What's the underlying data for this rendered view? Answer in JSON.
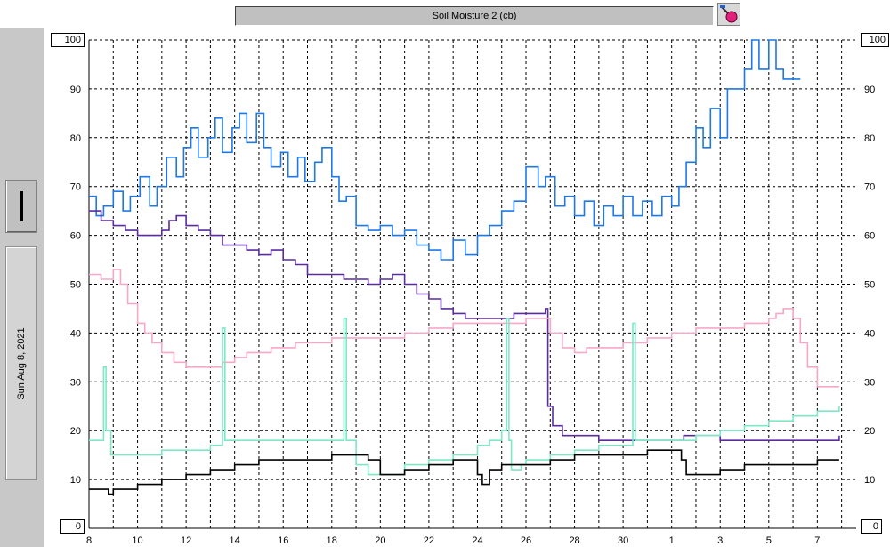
{
  "window": {
    "title": "Soil Moisture 2 (cb)"
  },
  "sidebar": {
    "date_label": "Sun Aug 8, 2021"
  },
  "axis_boxes": {
    "y_top": "100",
    "y_bottom": "0"
  },
  "colors": {
    "background": "#ffffff",
    "grid": "#000000",
    "series": [
      "#1e78e6",
      "#5a2ca0",
      "#f5a8c8",
      "#7ee8c4",
      "#000000"
    ]
  },
  "icons": {
    "title_icon": "paint-brush-icon",
    "sidebar_button": "vertical-bar-icon"
  },
  "chart_data": {
    "type": "line",
    "title": "Soil Moisture 2 (cb)",
    "xlabel": "",
    "ylabel": "",
    "ylim": [
      0,
      100
    ],
    "xlim": [
      8,
      39.6
    ],
    "x_ticks": [
      8,
      9,
      10,
      11,
      12,
      13,
      14,
      15,
      16,
      17,
      18,
      19,
      20,
      21,
      22,
      23,
      24,
      25,
      26,
      27,
      28,
      29,
      30,
      31,
      32,
      33,
      34,
      35,
      36,
      37,
      38,
      39
    ],
    "x_tick_labels": [
      "8",
      "",
      "10",
      "",
      "12",
      "",
      "14",
      "",
      "16",
      "",
      "18",
      "",
      "20",
      "",
      "22",
      "",
      "24",
      "",
      "26",
      "",
      "28",
      "",
      "30",
      "",
      "1",
      "",
      "3",
      "",
      "5",
      "",
      "7",
      ""
    ],
    "y_ticks": [
      10,
      20,
      30,
      40,
      50,
      60,
      70,
      80,
      90,
      100
    ],
    "y_tick_labels": [
      "10",
      "20",
      "30",
      "40",
      "50",
      "60",
      "70",
      "80",
      "90",
      "100"
    ],
    "grid": true,
    "legend": "none",
    "series": [
      {
        "color": "#1e78e6",
        "x": [
          8,
          8.3,
          8.6,
          9,
          9.4,
          9.7,
          10.1,
          10.5,
          10.8,
          11.2,
          11.6,
          11.9,
          12.2,
          12.5,
          12.9,
          13.2,
          13.5,
          13.9,
          14.2,
          14.5,
          14.9,
          15.2,
          15.5,
          15.9,
          16.2,
          16.6,
          16.9,
          17.3,
          17.6,
          18,
          18.3,
          18.6,
          19,
          19.5,
          20,
          20.5,
          21,
          21.5,
          22,
          22.5,
          23,
          23.5,
          24,
          24.5,
          25,
          25.5,
          26,
          26.5,
          26.8,
          27.2,
          27.6,
          28,
          28.4,
          28.8,
          29.2,
          29.6,
          30,
          30.4,
          30.8,
          31.2,
          31.6,
          32,
          32.3,
          32.6,
          33,
          33.3,
          33.6,
          34,
          34.3,
          34.6,
          35,
          35.3,
          35.6,
          36,
          36.3,
          36.6,
          37,
          37.3
        ],
        "values": [
          68,
          64,
          66,
          69,
          65,
          68,
          72,
          66,
          70,
          76,
          72,
          78,
          82,
          76,
          80,
          84,
          77,
          82,
          85,
          79,
          85,
          78,
          74,
          77,
          72,
          76,
          71,
          75,
          78,
          72,
          67,
          68,
          62,
          61,
          62,
          60,
          61,
          58,
          57,
          55,
          59,
          56,
          60,
          62,
          65,
          67,
          74,
          70,
          72,
          66,
          68,
          64,
          67,
          62,
          66,
          64,
          68,
          64,
          67,
          64,
          68,
          66,
          70,
          75,
          82,
          78,
          86,
          80,
          90,
          90,
          94,
          100,
          94,
          100,
          94,
          92,
          92,
          92
        ]
      },
      {
        "color": "#5a2ca0",
        "x": [
          8,
          8.5,
          9,
          9.5,
          10,
          10.5,
          11,
          11.3,
          11.6,
          12,
          12.5,
          13,
          13.5,
          14,
          14.5,
          15,
          15.5,
          16,
          16.5,
          17,
          17.5,
          18,
          18.5,
          19,
          19.5,
          20,
          20.5,
          21,
          21.5,
          22,
          22.5,
          23,
          23.5,
          24,
          24.5,
          25,
          25.5,
          26,
          26.5,
          26.8,
          26.9,
          27.1,
          27.5,
          28,
          29,
          30,
          31,
          32,
          32.5,
          33,
          34,
          35,
          36,
          37,
          38,
          38.9
        ],
        "values": [
          65,
          63,
          62,
          61,
          60,
          60,
          61,
          63,
          64,
          62,
          61,
          60,
          58,
          58,
          57,
          56,
          57,
          55,
          54,
          52,
          52,
          52,
          51,
          51,
          50,
          51,
          52,
          50,
          48,
          47,
          45,
          44,
          43,
          43,
          43,
          43,
          44,
          44,
          44,
          45,
          25,
          21,
          19,
          19,
          18,
          18,
          18,
          18,
          19,
          19,
          18,
          18,
          18,
          18,
          18,
          19
        ]
      },
      {
        "color": "#f5a8c8",
        "x": [
          8,
          8.5,
          9,
          9.3,
          9.6,
          10,
          10.3,
          10.6,
          11,
          11.5,
          12,
          12.5,
          13,
          13.5,
          14,
          14.5,
          15,
          15.5,
          16,
          16.5,
          17,
          17.5,
          18,
          19,
          20,
          21,
          22,
          23,
          24,
          25,
          26,
          26.5,
          27,
          27.5,
          28,
          28.5,
          29,
          30,
          31,
          32,
          33,
          34,
          35,
          36,
          36.3,
          36.6,
          37,
          37.3,
          37.6,
          38,
          38.9
        ],
        "values": [
          52,
          51,
          53,
          50,
          46,
          42,
          40,
          38,
          36,
          34,
          33,
          33,
          33,
          34,
          35,
          36,
          36,
          37,
          37,
          38,
          38,
          38,
          39,
          39,
          39,
          40,
          41,
          42,
          42,
          42,
          43,
          43,
          40,
          37,
          36,
          37,
          37,
          38,
          39,
          40,
          41,
          41,
          42,
          43,
          44,
          45,
          43,
          38,
          33,
          29,
          29
        ]
      },
      {
        "color": "#7ee8c4",
        "x": [
          8,
          8.5,
          8.6,
          8.7,
          8.9,
          9,
          10,
          11,
          12,
          13,
          13.4,
          13.5,
          13.6,
          14,
          15,
          16,
          17,
          18,
          18.4,
          18.5,
          18.6,
          19,
          19.5,
          20,
          21,
          22,
          23,
          24,
          24.5,
          25,
          25.2,
          25.3,
          25.4,
          25.8,
          26,
          27,
          28,
          29,
          30,
          30.3,
          30.4,
          30.5,
          31,
          32,
          33,
          34,
          35,
          36,
          37,
          38,
          38.9
        ],
        "values": [
          18,
          18,
          33,
          20,
          15,
          15,
          15,
          16,
          16,
          17,
          17,
          41,
          18,
          18,
          18,
          18,
          18,
          18,
          18,
          43,
          18,
          13,
          11,
          11,
          13,
          14,
          15,
          17,
          18,
          20,
          43,
          18,
          12,
          13,
          14,
          15,
          16,
          17,
          17,
          17,
          42,
          18,
          18,
          18,
          19,
          20,
          21,
          22,
          23,
          24,
          25
        ]
      },
      {
        "color": "#000000",
        "x": [
          8,
          8.5,
          8.8,
          9,
          10,
          11,
          12,
          13,
          14,
          15,
          16,
          17,
          18,
          19,
          19.5,
          20,
          21,
          22,
          23,
          23.5,
          24,
          24.2,
          24.5,
          25,
          26,
          27,
          28,
          29,
          30,
          31,
          32,
          32.4,
          32.6,
          32.8,
          33,
          34,
          35,
          36,
          37,
          38,
          38.9
        ],
        "values": [
          8,
          8,
          7,
          8,
          9,
          10,
          11,
          12,
          13,
          14,
          14,
          14,
          15,
          15,
          14,
          11,
          12,
          13,
          14,
          14,
          11,
          9,
          12,
          13,
          13,
          14,
          15,
          15,
          15,
          16,
          16,
          14,
          11,
          11,
          11,
          12,
          13,
          13,
          13,
          14,
          14
        ]
      }
    ]
  }
}
